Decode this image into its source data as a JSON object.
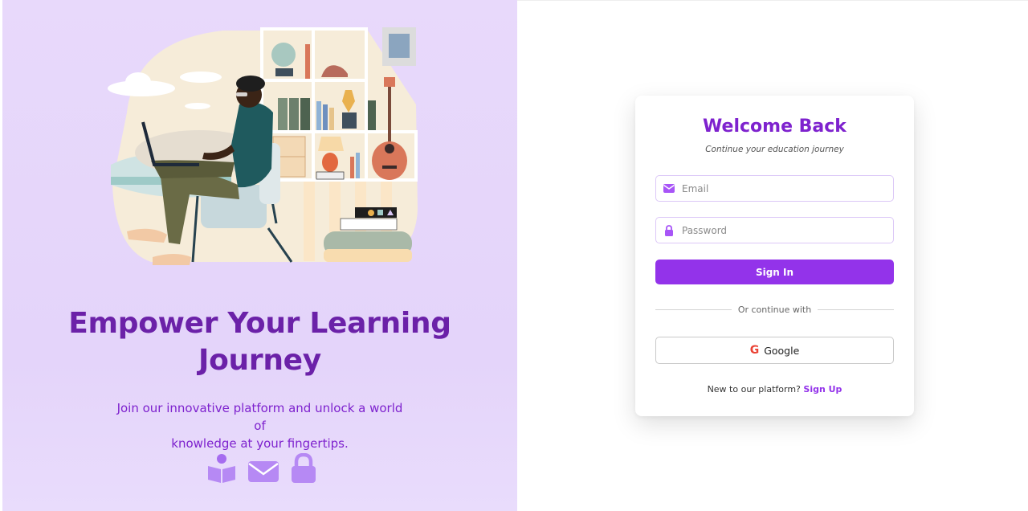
{
  "colors": {
    "brand_purple": "#9333ea",
    "heading_purple": "#6b21a8",
    "left_bg": "#e8d9fb",
    "field_border": "#dcc8f7",
    "google_red": "#ea4335"
  },
  "hero": {
    "title_line1": "Empower Your Learning",
    "title_line2": "Journey",
    "subtitle_line1": "Join our innovative platform and unlock a world of",
    "subtitle_line2": "knowledge at your fingertips.",
    "illustration": "person-with-laptop-bookshelf-illustration",
    "icons": [
      "book-reader-icon",
      "envelope-icon",
      "lock-icon"
    ]
  },
  "login": {
    "title": "Welcome Back",
    "subtitle": "Continue your education journey",
    "email": {
      "icon": "envelope-icon",
      "placeholder": "Email",
      "value": ""
    },
    "password": {
      "icon": "lock-icon",
      "placeholder": "Password",
      "value": ""
    },
    "signin_label": "Sign In",
    "divider_text": "Or continue with",
    "google": {
      "icon": "google-icon",
      "icon_glyph": "G",
      "label": "Google"
    },
    "signup_prompt": "New to our platform?",
    "signup_link": "Sign Up"
  }
}
